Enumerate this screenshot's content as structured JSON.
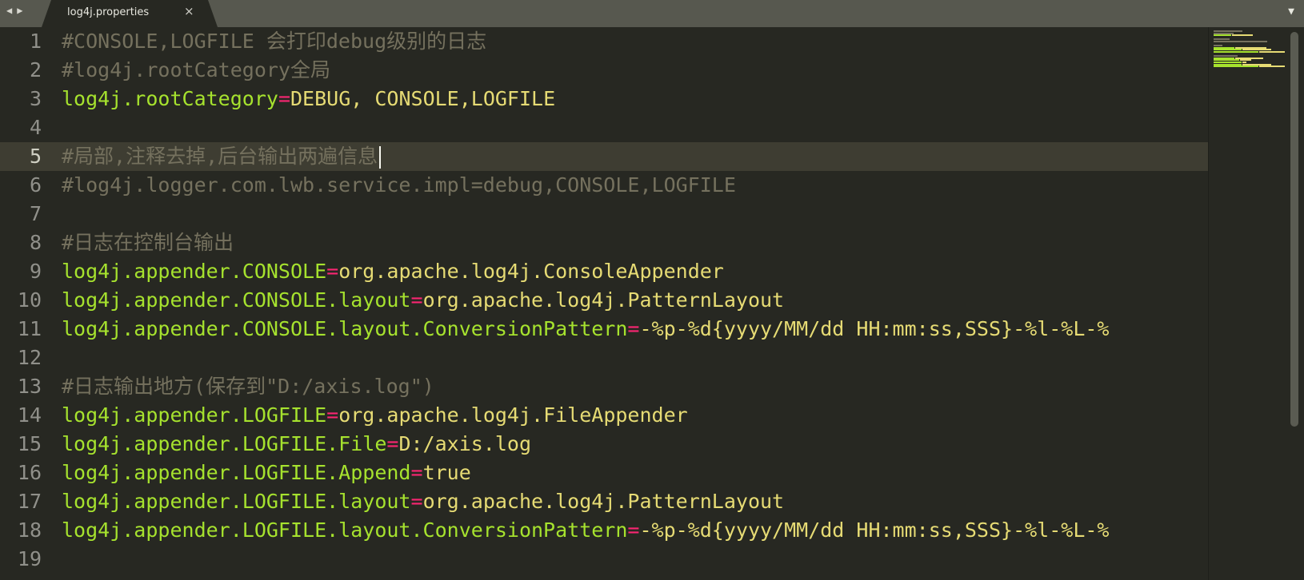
{
  "tab": {
    "title": "log4j.properties",
    "close": "×"
  },
  "nav": {
    "back": "◀",
    "forward": "▶"
  },
  "dropdown": "▼",
  "active_line": 5,
  "lines": [
    {
      "n": "1",
      "type": "comment",
      "text": "#CONSOLE,LOGFILE 会打印debug级别的日志"
    },
    {
      "n": "2",
      "type": "comment",
      "text": "#log4j.rootCategory全局"
    },
    {
      "n": "3",
      "type": "kv",
      "key": "log4j.rootCategory",
      "eq": "=",
      "value": "DEBUG, CONSOLE,LOGFILE"
    },
    {
      "n": "4",
      "type": "blank"
    },
    {
      "n": "5",
      "type": "comment",
      "text": "#局部,注释去掉,后台输出两遍信息"
    },
    {
      "n": "6",
      "type": "comment",
      "text": "#log4j.logger.com.lwb.service.impl=debug,CONSOLE,LOGFILE"
    },
    {
      "n": "7",
      "type": "blank"
    },
    {
      "n": "8",
      "type": "comment",
      "text": "#日志在控制台输出"
    },
    {
      "n": "9",
      "type": "kv",
      "key": "log4j.appender.CONSOLE",
      "eq": "=",
      "value": "org.apache.log4j.ConsoleAppender"
    },
    {
      "n": "10",
      "type": "kv",
      "key": "log4j.appender.CONSOLE.layout",
      "eq": "=",
      "value": "org.apache.log4j.PatternLayout"
    },
    {
      "n": "11",
      "type": "kv",
      "key": "log4j.appender.CONSOLE.layout.ConversionPattern",
      "eq": "=",
      "value": "-%p-%d{yyyy/MM/dd HH:mm:ss,SSS}-%l-%L-%"
    },
    {
      "n": "12",
      "type": "blank"
    },
    {
      "n": "13",
      "type": "comment",
      "text": "#日志输出地方(保存到\"D:/axis.log\")"
    },
    {
      "n": "14",
      "type": "kv",
      "key": "log4j.appender.LOGFILE",
      "eq": "=",
      "value": "org.apache.log4j.FileAppender"
    },
    {
      "n": "15",
      "type": "kv",
      "key": "log4j.appender.LOGFILE.File",
      "eq": "=",
      "value": "D:/axis.log"
    },
    {
      "n": "16",
      "type": "kv",
      "key": "log4j.appender.LOGFILE.Append",
      "eq": "=",
      "value": "true"
    },
    {
      "n": "17",
      "type": "kv",
      "key": "log4j.appender.LOGFILE.layout",
      "eq": "=",
      "value": "org.apache.log4j.PatternLayout"
    },
    {
      "n": "18",
      "type": "kv",
      "key": "log4j.appender.LOGFILE.layout.ConversionPattern",
      "eq": "=",
      "value": "-%p-%d{yyyy/MM/dd HH:mm:ss,SSS}-%l-%L-%"
    },
    {
      "n": "19",
      "type": "blank"
    }
  ],
  "colors": {
    "background": "#272822",
    "comment": "#75715e",
    "key": "#a6e22e",
    "operator": "#f92672",
    "value": "#e6db74"
  }
}
